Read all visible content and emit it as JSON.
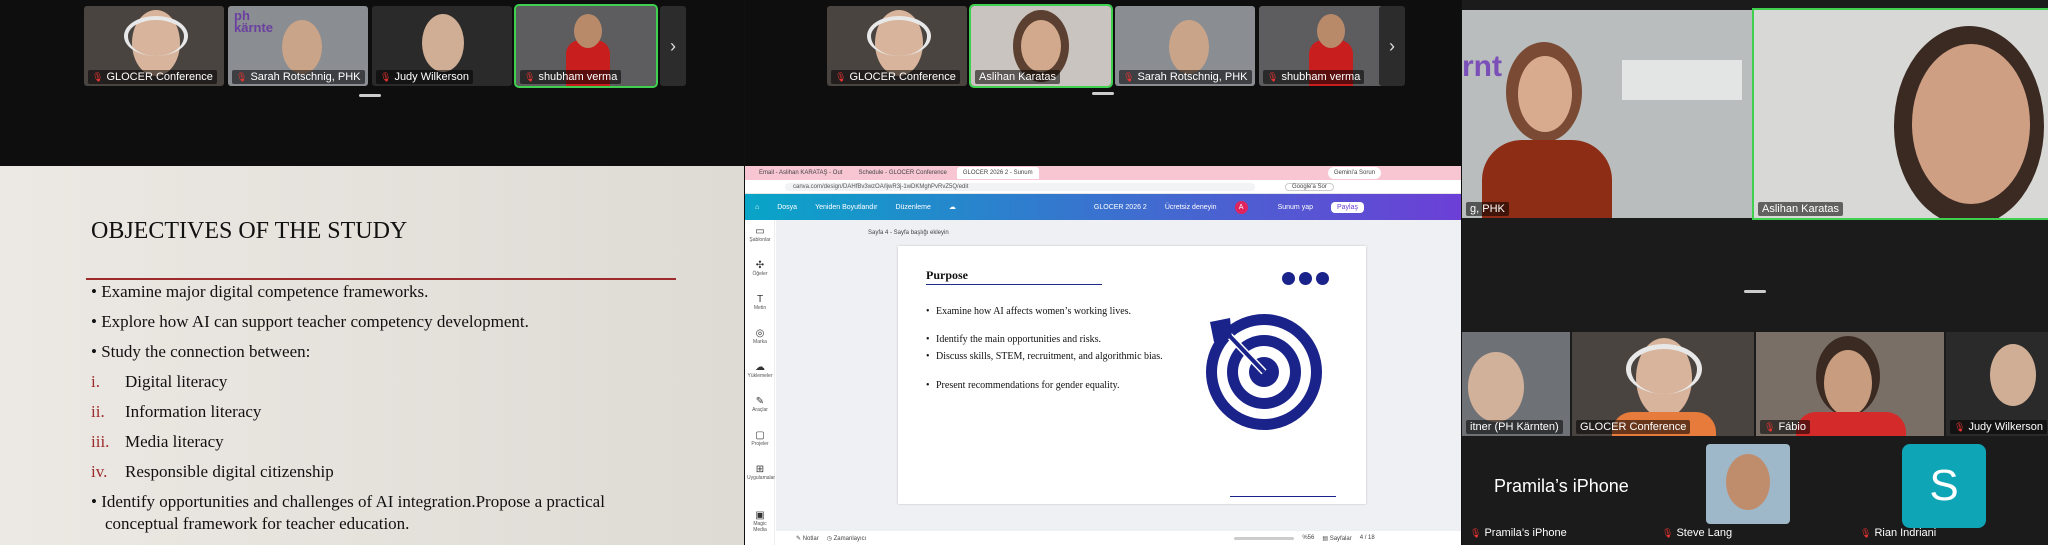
{
  "panel1": {
    "participants": [
      {
        "name": "GLOCER Conference",
        "muted": true
      },
      {
        "name": "Sarah Rotschnig, PHK",
        "muted": true
      },
      {
        "name": "Judy Wilkerson",
        "muted": true
      },
      {
        "name": "shubham verma",
        "muted": true
      }
    ],
    "next_icon": "›",
    "logo_text": "ph\nkärnte",
    "slide": {
      "title": "OBJECTIVES OF THE STUDY",
      "bullets": [
        "Examine major digital competence frameworks.",
        "Explore how AI can support teacher competency development.",
        "Study the connection between:"
      ],
      "numbered": [
        {
          "num": "i.",
          "text": "Digital literacy"
        },
        {
          "num": "ii.",
          "text": "Information literacy"
        },
        {
          "num": "iii.",
          "text": "Media literacy"
        },
        {
          "num": "iv.",
          "text": "Responsible digital citizenship"
        }
      ],
      "final_bullet_1": "Identify opportunities and challenges of AI integration.Propose a practical",
      "final_bullet_2": "conceptual framework for teacher education."
    }
  },
  "panel2": {
    "participants": [
      {
        "name": "GLOCER Conference",
        "muted": true
      },
      {
        "name": "Aslihan Karatas",
        "muted": false
      },
      {
        "name": "Sarah Rotschnig, PHK",
        "muted": true
      },
      {
        "name": "shubham verma",
        "muted": true
      }
    ],
    "next_icon": "›",
    "browser": {
      "tabs": [
        "Email - Aslihan KARATAŞ - Out",
        "Schedule - GLOCER Conference",
        "GLOCER 2026 2 - Sunum"
      ],
      "gemini_label": "Gemini'a Sorun",
      "url": "canva.com/design/DAHfBv3wzOA/ljwR3j-1wDKMghPvRvZ5Q/edit",
      "google_label": "Google'a Sor",
      "canva_menu": [
        "Dosya",
        "Yeniden Boyutlandır",
        "Düzenleme"
      ],
      "doc_title": "GLOCER 2026 2",
      "trial_label": "Ücretsiz deneyin",
      "avatar_letter": "A",
      "present_label": "Sunum yap",
      "share_label": "Paylaş",
      "sidebar": [
        "Şablonlar",
        "Öğeler",
        "Metin",
        "Marka",
        "Yüklemeler",
        "Araçlar",
        "Projeler",
        "Uygulamalar",
        "Magic Media"
      ],
      "page_label": "Sayfa 4 - Sayfa başlığı ekleyin",
      "slide": {
        "title": "Purpose",
        "bullets": [
          "Examine how AI affects women’s working lives.",
          "Identify the main opportunities and risks.",
          "Discuss skills, STEM, recruitment, and algorithmic bias.",
          "Present recommendations for gender equality."
        ]
      },
      "status": {
        "notes": "Notlar",
        "timer": "Zamanlayıcı",
        "zoom": "%56",
        "pages": "Sayfalar",
        "page_count": "4 / 18"
      }
    }
  },
  "panel3": {
    "top_left_name": "g, PHK",
    "top_right_name": "Aslihan Karatas",
    "middle_row": [
      {
        "name": "itner (PH Kärnten)",
        "muted": false
      },
      {
        "name": "GLOCER Conference",
        "muted": false
      },
      {
        "name": "Fábio",
        "muted": true
      },
      {
        "name": "Judy Wilkerson",
        "muted": true
      }
    ],
    "bottom_row": [
      {
        "big": "Pramila’s iPhone",
        "name": "Pramila’s iPhone",
        "muted": true
      },
      {
        "name": "Steve Lang",
        "muted": true
      },
      {
        "letter": "S",
        "name": "Rian Indriani",
        "muted": true
      }
    ]
  },
  "colors": {
    "active_speaker": "#3fd04f",
    "mic_muted": "#e33333",
    "slide_rule": "#9d2b2b",
    "canva_navy": "#1a238a",
    "avatar_teal": "#0ea5b7"
  }
}
